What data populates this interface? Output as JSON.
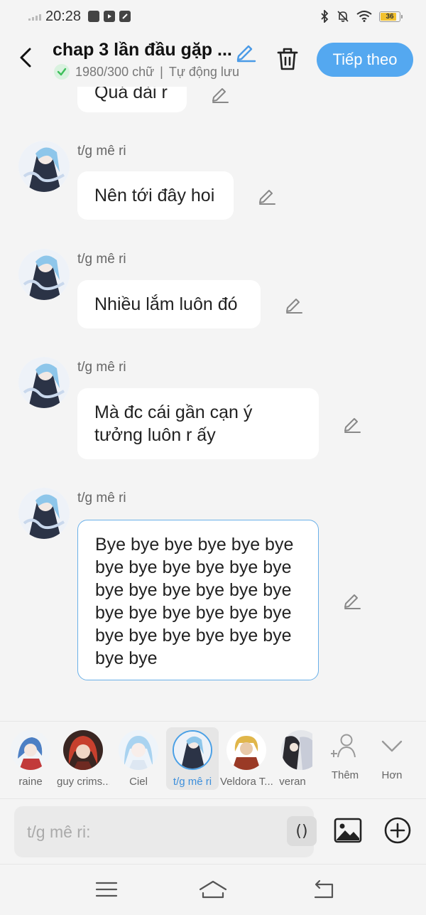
{
  "status_bar": {
    "time": "20:28",
    "battery": "36",
    "icons": [
      "signal-icon",
      "notification-app-icon",
      "youtube-icon",
      "app-icon",
      "bluetooth-icon",
      "mute-icon",
      "wifi-icon",
      "battery-icon"
    ]
  },
  "header": {
    "title": "chap 3 lần đầu gặp ...",
    "word_count": "1980/300 chữ",
    "separator": "|",
    "autosave": "Tự động lưu",
    "next_label": "Tiếp theo",
    "accent_color": "#54a8f0"
  },
  "messages": [
    {
      "sender": "",
      "text": "Quá dài r"
    },
    {
      "sender": "t/g mê ri",
      "text": "Nên tới đây hoi"
    },
    {
      "sender": "t/g mê ri",
      "text": "Nhiều lắm luôn đó"
    },
    {
      "sender": "t/g mê ri",
      "text": "Mà đc cái gần cạn ý tưởng luôn r ấy"
    },
    {
      "sender": "t/g mê ri",
      "text": "Bye bye bye bye bye bye bye bye bye bye bye bye bye bye bye bye bye bye bye bye bye bye bye bye bye bye bye bye bye bye bye bye"
    }
  ],
  "characters": [
    {
      "name": "raine"
    },
    {
      "name": "guy crims..."
    },
    {
      "name": "Ciel"
    },
    {
      "name": "t/g mê ri"
    },
    {
      "name": "Veldora T..."
    },
    {
      "name": "veran"
    }
  ],
  "tools": {
    "add_label": "Thêm",
    "more_label": "Hơn"
  },
  "input": {
    "placeholder": "t/g mê ri:",
    "paren_label": "()"
  }
}
